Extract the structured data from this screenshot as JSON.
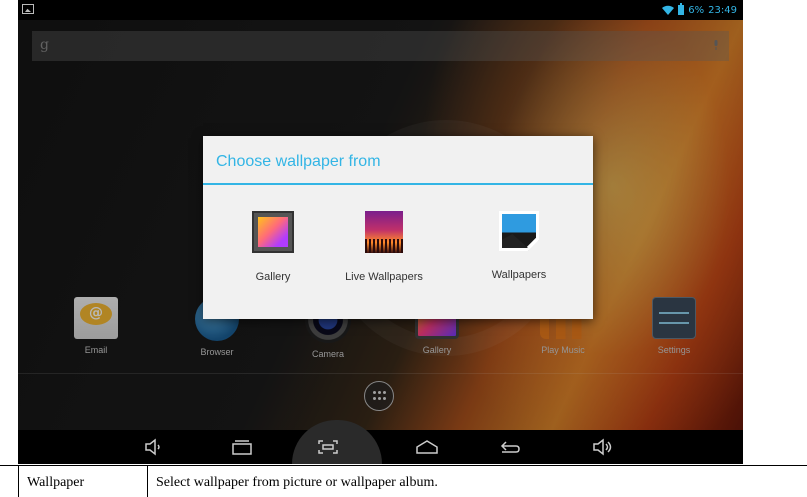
{
  "status_bar": {
    "battery": "6%",
    "time": "23:49",
    "accent": "#33b5e5"
  },
  "search": {
    "google_glyph": "g"
  },
  "dock_apps": [
    {
      "label": "Email"
    },
    {
      "label": "Browser"
    },
    {
      "label": "Camera"
    },
    {
      "label": "Gallery"
    },
    {
      "label": "Play Music"
    },
    {
      "label": "Settings"
    }
  ],
  "dialog": {
    "title": "Choose wallpaper from",
    "options": [
      {
        "label": "Gallery",
        "icon": "gallery-icon"
      },
      {
        "label": "Live Wallpapers",
        "icon": "live-wallpaper-icon"
      },
      {
        "label": "Wallpapers",
        "icon": "wallpapers-icon"
      }
    ]
  },
  "nav_bar": {
    "buttons": [
      "volume-down-icon",
      "recent-apps-icon",
      "screenshot-icon",
      "home-icon",
      "back-icon",
      "volume-up-icon"
    ]
  },
  "caption": {
    "term": "Wallpaper",
    "description": "Select wallpaper from picture or wallpaper album."
  }
}
